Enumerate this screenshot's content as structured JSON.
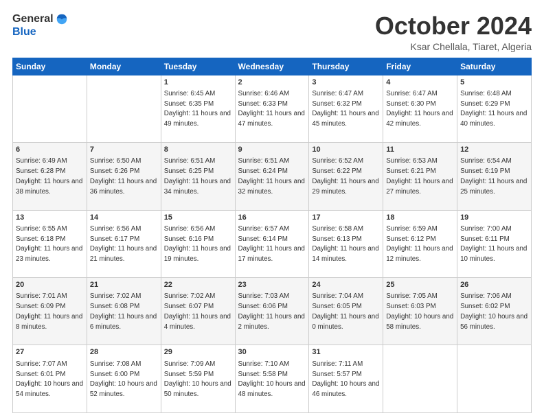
{
  "logo": {
    "general": "General",
    "blue": "Blue"
  },
  "header": {
    "month": "October 2024",
    "location": "Ksar Chellala, Tiaret, Algeria"
  },
  "days_of_week": [
    "Sunday",
    "Monday",
    "Tuesday",
    "Wednesday",
    "Thursday",
    "Friday",
    "Saturday"
  ],
  "weeks": [
    [
      {
        "day": "",
        "sunrise": "",
        "sunset": "",
        "daylight": ""
      },
      {
        "day": "",
        "sunrise": "",
        "sunset": "",
        "daylight": ""
      },
      {
        "day": "1",
        "sunrise": "Sunrise: 6:45 AM",
        "sunset": "Sunset: 6:35 PM",
        "daylight": "Daylight: 11 hours and 49 minutes."
      },
      {
        "day": "2",
        "sunrise": "Sunrise: 6:46 AM",
        "sunset": "Sunset: 6:33 PM",
        "daylight": "Daylight: 11 hours and 47 minutes."
      },
      {
        "day": "3",
        "sunrise": "Sunrise: 6:47 AM",
        "sunset": "Sunset: 6:32 PM",
        "daylight": "Daylight: 11 hours and 45 minutes."
      },
      {
        "day": "4",
        "sunrise": "Sunrise: 6:47 AM",
        "sunset": "Sunset: 6:30 PM",
        "daylight": "Daylight: 11 hours and 42 minutes."
      },
      {
        "day": "5",
        "sunrise": "Sunrise: 6:48 AM",
        "sunset": "Sunset: 6:29 PM",
        "daylight": "Daylight: 11 hours and 40 minutes."
      }
    ],
    [
      {
        "day": "6",
        "sunrise": "Sunrise: 6:49 AM",
        "sunset": "Sunset: 6:28 PM",
        "daylight": "Daylight: 11 hours and 38 minutes."
      },
      {
        "day": "7",
        "sunrise": "Sunrise: 6:50 AM",
        "sunset": "Sunset: 6:26 PM",
        "daylight": "Daylight: 11 hours and 36 minutes."
      },
      {
        "day": "8",
        "sunrise": "Sunrise: 6:51 AM",
        "sunset": "Sunset: 6:25 PM",
        "daylight": "Daylight: 11 hours and 34 minutes."
      },
      {
        "day": "9",
        "sunrise": "Sunrise: 6:51 AM",
        "sunset": "Sunset: 6:24 PM",
        "daylight": "Daylight: 11 hours and 32 minutes."
      },
      {
        "day": "10",
        "sunrise": "Sunrise: 6:52 AM",
        "sunset": "Sunset: 6:22 PM",
        "daylight": "Daylight: 11 hours and 29 minutes."
      },
      {
        "day": "11",
        "sunrise": "Sunrise: 6:53 AM",
        "sunset": "Sunset: 6:21 PM",
        "daylight": "Daylight: 11 hours and 27 minutes."
      },
      {
        "day": "12",
        "sunrise": "Sunrise: 6:54 AM",
        "sunset": "Sunset: 6:19 PM",
        "daylight": "Daylight: 11 hours and 25 minutes."
      }
    ],
    [
      {
        "day": "13",
        "sunrise": "Sunrise: 6:55 AM",
        "sunset": "Sunset: 6:18 PM",
        "daylight": "Daylight: 11 hours and 23 minutes."
      },
      {
        "day": "14",
        "sunrise": "Sunrise: 6:56 AM",
        "sunset": "Sunset: 6:17 PM",
        "daylight": "Daylight: 11 hours and 21 minutes."
      },
      {
        "day": "15",
        "sunrise": "Sunrise: 6:56 AM",
        "sunset": "Sunset: 6:16 PM",
        "daylight": "Daylight: 11 hours and 19 minutes."
      },
      {
        "day": "16",
        "sunrise": "Sunrise: 6:57 AM",
        "sunset": "Sunset: 6:14 PM",
        "daylight": "Daylight: 11 hours and 17 minutes."
      },
      {
        "day": "17",
        "sunrise": "Sunrise: 6:58 AM",
        "sunset": "Sunset: 6:13 PM",
        "daylight": "Daylight: 11 hours and 14 minutes."
      },
      {
        "day": "18",
        "sunrise": "Sunrise: 6:59 AM",
        "sunset": "Sunset: 6:12 PM",
        "daylight": "Daylight: 11 hours and 12 minutes."
      },
      {
        "day": "19",
        "sunrise": "Sunrise: 7:00 AM",
        "sunset": "Sunset: 6:11 PM",
        "daylight": "Daylight: 11 hours and 10 minutes."
      }
    ],
    [
      {
        "day": "20",
        "sunrise": "Sunrise: 7:01 AM",
        "sunset": "Sunset: 6:09 PM",
        "daylight": "Daylight: 11 hours and 8 minutes."
      },
      {
        "day": "21",
        "sunrise": "Sunrise: 7:02 AM",
        "sunset": "Sunset: 6:08 PM",
        "daylight": "Daylight: 11 hours and 6 minutes."
      },
      {
        "day": "22",
        "sunrise": "Sunrise: 7:02 AM",
        "sunset": "Sunset: 6:07 PM",
        "daylight": "Daylight: 11 hours and 4 minutes."
      },
      {
        "day": "23",
        "sunrise": "Sunrise: 7:03 AM",
        "sunset": "Sunset: 6:06 PM",
        "daylight": "Daylight: 11 hours and 2 minutes."
      },
      {
        "day": "24",
        "sunrise": "Sunrise: 7:04 AM",
        "sunset": "Sunset: 6:05 PM",
        "daylight": "Daylight: 11 hours and 0 minutes."
      },
      {
        "day": "25",
        "sunrise": "Sunrise: 7:05 AM",
        "sunset": "Sunset: 6:03 PM",
        "daylight": "Daylight: 10 hours and 58 minutes."
      },
      {
        "day": "26",
        "sunrise": "Sunrise: 7:06 AM",
        "sunset": "Sunset: 6:02 PM",
        "daylight": "Daylight: 10 hours and 56 minutes."
      }
    ],
    [
      {
        "day": "27",
        "sunrise": "Sunrise: 7:07 AM",
        "sunset": "Sunset: 6:01 PM",
        "daylight": "Daylight: 10 hours and 54 minutes."
      },
      {
        "day": "28",
        "sunrise": "Sunrise: 7:08 AM",
        "sunset": "Sunset: 6:00 PM",
        "daylight": "Daylight: 10 hours and 52 minutes."
      },
      {
        "day": "29",
        "sunrise": "Sunrise: 7:09 AM",
        "sunset": "Sunset: 5:59 PM",
        "daylight": "Daylight: 10 hours and 50 minutes."
      },
      {
        "day": "30",
        "sunrise": "Sunrise: 7:10 AM",
        "sunset": "Sunset: 5:58 PM",
        "daylight": "Daylight: 10 hours and 48 minutes."
      },
      {
        "day": "31",
        "sunrise": "Sunrise: 7:11 AM",
        "sunset": "Sunset: 5:57 PM",
        "daylight": "Daylight: 10 hours and 46 minutes."
      },
      {
        "day": "",
        "sunrise": "",
        "sunset": "",
        "daylight": ""
      },
      {
        "day": "",
        "sunrise": "",
        "sunset": "",
        "daylight": ""
      }
    ]
  ]
}
